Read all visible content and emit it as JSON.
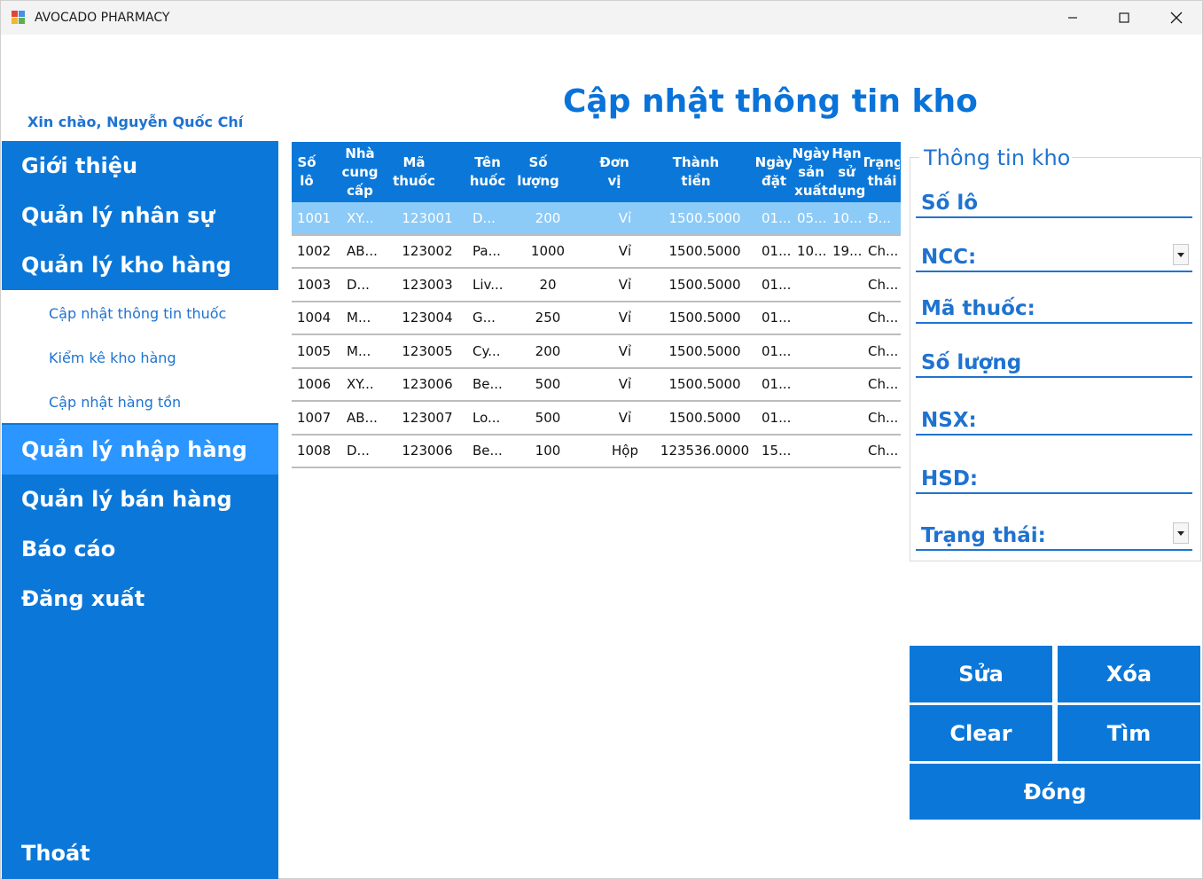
{
  "window": {
    "title": "AVOCADO PHARMACY"
  },
  "greeting": "Xin chào, Nguyễn Quốc Chí",
  "page_title": "Cập nhật thông tin kho",
  "sidebar": {
    "items": [
      {
        "label": "Giới thiệu"
      },
      {
        "label": "Quản lý nhân sự"
      },
      {
        "label": "Quản lý kho hàng"
      },
      {
        "label": "Quản lý nhập hàng"
      },
      {
        "label": "Quản lý bán hàng"
      },
      {
        "label": "Báo cáo"
      },
      {
        "label": "Đăng xuất"
      }
    ],
    "subitems": [
      {
        "label": "Cập nhật thông tin thuốc"
      },
      {
        "label": "Kiểm kê kho hàng"
      },
      {
        "label": "Cập nhật hàng tồn"
      }
    ],
    "exit_label": "Thoát"
  },
  "table": {
    "columns": [
      "Số\nlô",
      "Nhà\ncung\ncấp",
      "Mã\nthuốc",
      "Tên\nhuốc",
      "Số\nlượng",
      "Đơn\nvị",
      "Thành\ntiền",
      "Ngày\nđặt",
      "Ngày\nsản\nxuất",
      "Hạn\nsử\ndụng",
      "Trạng\nthái"
    ],
    "rows": [
      [
        "1001",
        "XY...",
        "123001",
        "D...",
        "200",
        "Vỉ",
        "1500.5000",
        "01...",
        "05...",
        "10...",
        "Đ..."
      ],
      [
        "1002",
        "AB...",
        "123002",
        "Pa...",
        "1000",
        "Vỉ",
        "1500.5000",
        "01...",
        "10...",
        "19...",
        "Ch..."
      ],
      [
        "1003",
        "D...",
        "123003",
        "Liv...",
        "20",
        "Vỉ",
        "1500.5000",
        "01...",
        "",
        "",
        "Ch..."
      ],
      [
        "1004",
        "M...",
        "123004",
        "G...",
        "250",
        "Vỉ",
        "1500.5000",
        "01...",
        "",
        "",
        "Ch..."
      ],
      [
        "1005",
        "M...",
        "123005",
        "Cy...",
        "200",
        "Vỉ",
        "1500.5000",
        "01...",
        "",
        "",
        "Ch..."
      ],
      [
        "1006",
        "XY...",
        "123006",
        "Be...",
        "500",
        "Vỉ",
        "1500.5000",
        "01...",
        "",
        "",
        "Ch..."
      ],
      [
        "1007",
        "AB...",
        "123007",
        "Lo...",
        "500",
        "Vỉ",
        "1500.5000",
        "01...",
        "",
        "",
        "Ch..."
      ],
      [
        "1008",
        "D...",
        "123006",
        "Be...",
        "100",
        "Hộp",
        "123536.0000",
        "15...",
        "",
        "",
        "Ch..."
      ]
    ],
    "selected_row": 0
  },
  "info_panel": {
    "legend": "Thông tin kho",
    "fields": [
      {
        "label": "Số lô",
        "value": ""
      },
      {
        "label": "NCC:",
        "value": ""
      },
      {
        "label": "Mã thuốc:",
        "value": ""
      },
      {
        "label": "Số lượng",
        "value": ""
      },
      {
        "label": "NSX:",
        "value": ""
      },
      {
        "label": "HSD:",
        "value": ""
      },
      {
        "label": "Trạng thái:",
        "value": ""
      }
    ]
  },
  "buttons": {
    "edit": "Sửa",
    "delete": "Xóa",
    "clear": "Clear",
    "find": "Tìm",
    "close": "Đóng"
  },
  "colors": {
    "primary": "#0b78d9",
    "active_nav": "#2b96ff",
    "selected_row": "#8ccaf7",
    "text_blue": "#1f73d0"
  }
}
